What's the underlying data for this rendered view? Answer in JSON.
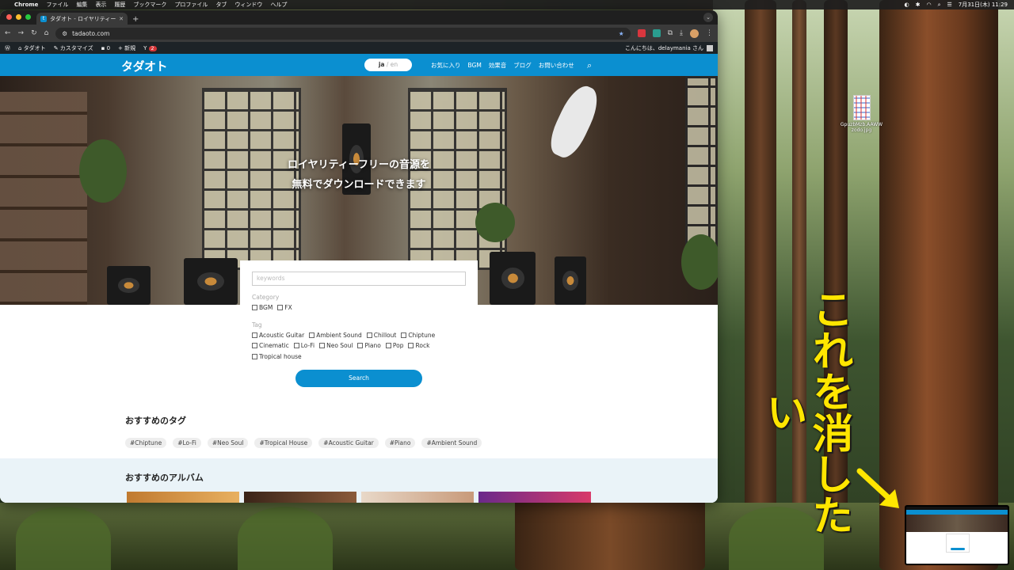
{
  "menubar": {
    "app": "Chrome",
    "items": [
      "ファイル",
      "編集",
      "表示",
      "履歴",
      "ブックマーク",
      "プロファイル",
      "タブ",
      "ウィンドウ",
      "ヘルプ"
    ],
    "datetime": "7月31日(木) 11:29"
  },
  "desktop": {
    "file_name": "GpuzbMzb.AAWWzodo.jpg"
  },
  "annotation": {
    "text": "これを消したい",
    "color": "#ffe600"
  },
  "browser": {
    "tab_title": "タダオト - ロイヤリティーフリー…",
    "tab_favicon": "t",
    "url": "tadaoto.com"
  },
  "adminbar": {
    "site": "タダオト",
    "customize": "カスタマイズ",
    "comments": "0",
    "new": "新規",
    "yoast_count": "2",
    "greeting": "こんにちは、delaymania さん"
  },
  "header": {
    "logo": "タダオト",
    "lang_ja": "ja",
    "lang_sep": " / ",
    "lang_en": "en",
    "nav": [
      "お気に入り",
      "BGM",
      "効果音",
      "ブログ",
      "お問い合わせ"
    ]
  },
  "hero": {
    "line1": "ロイヤリティーフリーの音源を",
    "line2": "無料でダウンロードできます"
  },
  "search": {
    "placeholder": "keywords",
    "category_label": "Category",
    "categories": [
      "BGM",
      "FX"
    ],
    "tag_label": "Tag",
    "tags": [
      "Acoustic Guitar",
      "Ambient Sound",
      "Chillout",
      "Chiptune",
      "Cinematic",
      "Lo-Fi",
      "Neo Soul",
      "Piano",
      "Pop",
      "Rock",
      "Tropical house"
    ],
    "button": "Search"
  },
  "recommended_tags": {
    "heading": "おすすめのタグ",
    "tags": [
      "#Chiptune",
      "#Lo-Fi",
      "#Neo Soul",
      "#Tropical House",
      "#Acoustic Guitar",
      "#Piano",
      "#Ambient Sound"
    ]
  },
  "albums": {
    "heading": "おすすめのアルバム"
  },
  "colors": {
    "accent": "#0b8fd0",
    "admin_bar": "#1d2327"
  }
}
